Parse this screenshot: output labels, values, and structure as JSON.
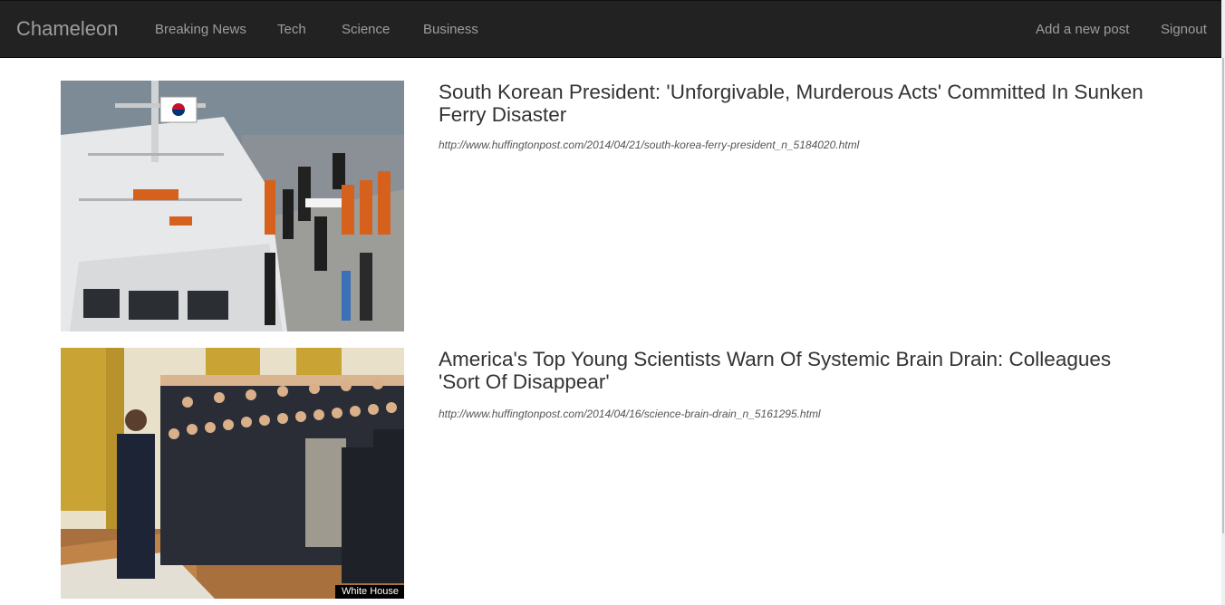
{
  "navbar": {
    "brand": "Chameleon",
    "links": [
      {
        "label": "Breaking News"
      },
      {
        "label": "Tech"
      },
      {
        "label": "Science"
      },
      {
        "label": "Business"
      }
    ],
    "right_links": [
      {
        "label": "Add a new post"
      },
      {
        "label": "Signout"
      }
    ]
  },
  "posts": [
    {
      "title": "South Korean President: 'Unforgivable, Murderous Acts' Committed In Sunken Ferry Disaster",
      "url": "http://www.huffingtonpost.com/2014/04/21/south-korea-ferry-president_n_5184020.html",
      "image_subject": "coast guard ship rescue scene with workers in orange suits",
      "image_credit": ""
    },
    {
      "title": "America's Top Young Scientists Warn Of Systemic Brain Drain: Colleagues 'Sort Of Disappear'",
      "url": "http://www.huffingtonpost.com/2014/04/16/science-brain-drain_n_5161295.html",
      "image_subject": "president standing before a large group of young scientists in an ornate room",
      "image_credit": "White House"
    }
  ],
  "colors": {
    "navbar_bg": "#222222",
    "nav_text": "#9d9d9d",
    "title_text": "#333333"
  }
}
